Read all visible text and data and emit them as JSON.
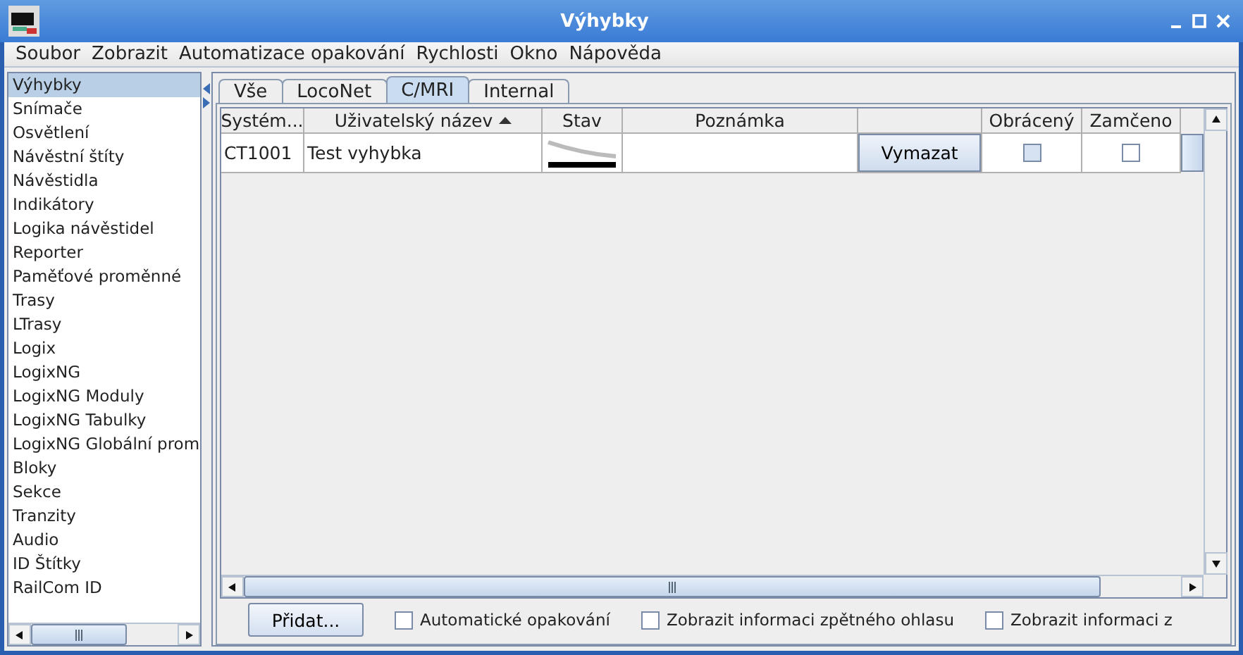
{
  "window": {
    "title": "Výhybky"
  },
  "menu": [
    "Soubor",
    "Zobrazit",
    "Automatizace opakování",
    "Rychlosti",
    "Okno",
    "Nápověda"
  ],
  "sidebar": {
    "items": [
      {
        "label": "Výhybky",
        "selected": true
      },
      {
        "label": "Snímače",
        "selected": false
      },
      {
        "label": "Osvětlení",
        "selected": false
      },
      {
        "label": "Návěstní štíty",
        "selected": false
      },
      {
        "label": "Návěstidla",
        "selected": false
      },
      {
        "label": "Indikátory",
        "selected": false
      },
      {
        "label": "Logika návěstidel",
        "selected": false
      },
      {
        "label": "Reporter",
        "selected": false
      },
      {
        "label": "Paměťové proměnné",
        "selected": false
      },
      {
        "label": "Trasy",
        "selected": false
      },
      {
        "label": "LTrasy",
        "selected": false
      },
      {
        "label": "Logix",
        "selected": false
      },
      {
        "label": "LogixNG",
        "selected": false
      },
      {
        "label": "LogixNG Moduly",
        "selected": false
      },
      {
        "label": "LogixNG Tabulky",
        "selected": false
      },
      {
        "label": "LogixNG Globální prom",
        "selected": false
      },
      {
        "label": "Bloky",
        "selected": false
      },
      {
        "label": "Sekce",
        "selected": false
      },
      {
        "label": "Tranzity",
        "selected": false
      },
      {
        "label": "Audio",
        "selected": false
      },
      {
        "label": "ID Štítky",
        "selected": false
      },
      {
        "label": "RailCom ID",
        "selected": false
      }
    ]
  },
  "tabs": [
    {
      "label": "Vše",
      "selected": false
    },
    {
      "label": "LocoNet",
      "selected": false
    },
    {
      "label": "C/MRI",
      "selected": true
    },
    {
      "label": "Internal",
      "selected": false
    }
  ],
  "table": {
    "columns": [
      "Systém...",
      "Uživatelský název",
      "Stav",
      "Poznámka",
      "",
      "Obrácený",
      "Zamčeno"
    ],
    "rows": [
      {
        "system": "CT1001",
        "user_name": "Test vyhybka",
        "comment": "",
        "button": "Vymazat",
        "inverted": false,
        "inverted_focused": true,
        "locked": false
      }
    ]
  },
  "bottom": {
    "add_button": "Přidat...",
    "checks": [
      {
        "label": "Automatické opakování",
        "checked": false
      },
      {
        "label": "Zobrazit informaci zpětného ohlasu",
        "checked": false
      },
      {
        "label": "Zobrazit informaci z",
        "checked": false
      }
    ]
  }
}
